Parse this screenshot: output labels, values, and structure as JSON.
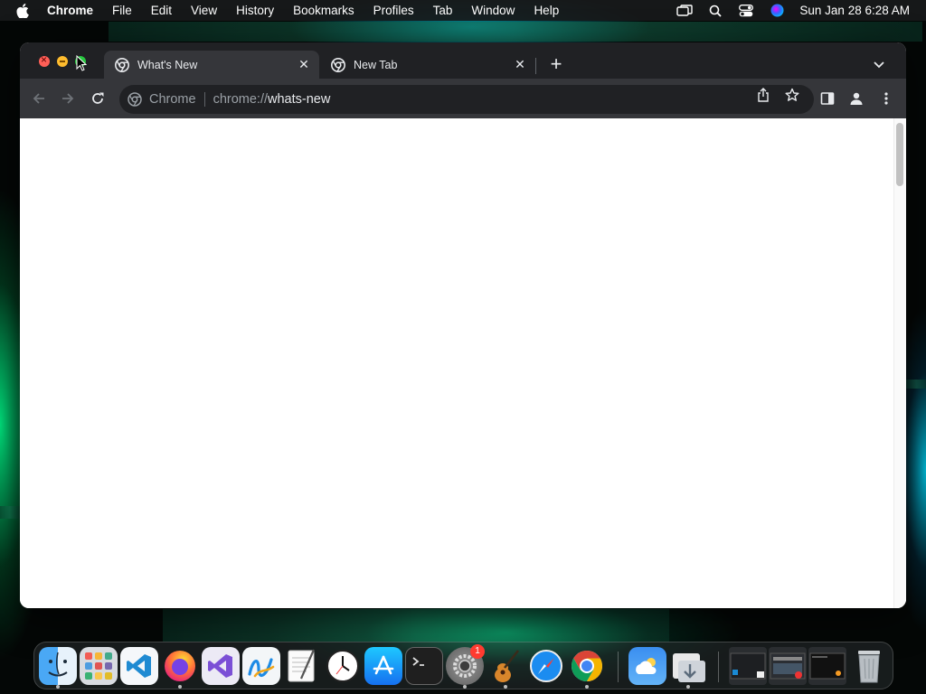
{
  "menubar": {
    "app_name": "Chrome",
    "items": [
      "File",
      "Edit",
      "View",
      "History",
      "Bookmarks",
      "Profiles",
      "Tab",
      "Window",
      "Help"
    ],
    "clock": "Sun Jan 28  6:28 AM"
  },
  "browser": {
    "tabs": [
      {
        "title": "What's New",
        "active": true
      },
      {
        "title": "New Tab",
        "active": false
      }
    ],
    "omnibox": {
      "scheme_label": "Chrome",
      "url_prefix": "chrome://",
      "url_host": "whats-new"
    }
  },
  "dock": {
    "apps": [
      {
        "name": "Finder",
        "icon": "finder-icon",
        "running": true
      },
      {
        "name": "Launchpad",
        "icon": "launchpad-icon",
        "running": false
      },
      {
        "name": "Visual Studio Code",
        "icon": "vscode-icon",
        "running": false
      },
      {
        "name": "Firefox",
        "icon": "firefox-icon",
        "running": true
      },
      {
        "name": "Visual Studio",
        "icon": "visual-studio-icon",
        "running": false
      },
      {
        "name": "Freeform",
        "icon": "freeform-icon",
        "running": false
      },
      {
        "name": "TextEdit",
        "icon": "textedit-icon",
        "running": false
      },
      {
        "name": "Clock",
        "icon": "clock-icon",
        "running": false
      },
      {
        "name": "App Store",
        "icon": "app-store-icon",
        "running": false
      },
      {
        "name": "Terminal",
        "icon": "terminal-icon",
        "running": false
      },
      {
        "name": "System Settings",
        "icon": "system-settings-icon",
        "running": true,
        "badge": "1"
      },
      {
        "name": "GarageBand",
        "icon": "garageband-icon",
        "running": true
      },
      {
        "name": "Safari",
        "icon": "safari-icon",
        "running": false
      },
      {
        "name": "Google Chrome",
        "icon": "chrome-icon",
        "running": true
      },
      {
        "name": "Weather",
        "icon": "weather-icon",
        "running": false
      },
      {
        "name": "Downloads",
        "icon": "downloads-icon",
        "running": true
      },
      {
        "name": "Minimized Window 1",
        "icon": "window-thumbnail-icon",
        "running": false
      },
      {
        "name": "Minimized Window 2",
        "icon": "window-thumbnail-icon",
        "running": false
      },
      {
        "name": "Minimized Window 3",
        "icon": "window-thumbnail-icon",
        "running": false
      },
      {
        "name": "Trash",
        "icon": "trash-icon",
        "running": false
      }
    ]
  },
  "colors": {
    "tabstrip_bg": "#202124",
    "toolbar_bg": "#35363a",
    "omnibox_bg": "#202124",
    "text_primary": "#e8eaed",
    "text_secondary": "#9aa0a6",
    "traffic_close": "#ff5f57",
    "traffic_minimize": "#febc2e",
    "traffic_maximize": "#28c840"
  }
}
